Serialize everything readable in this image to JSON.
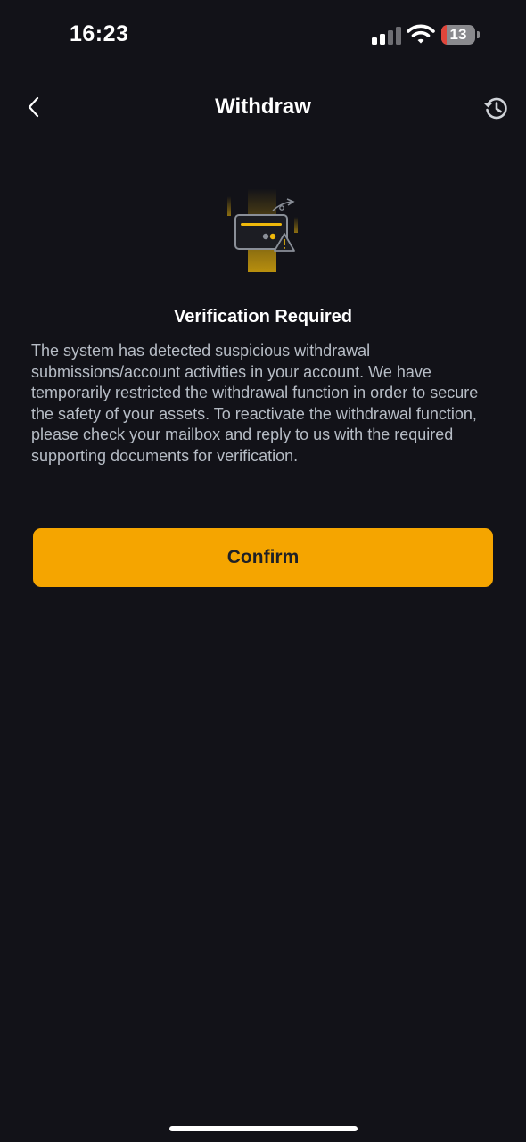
{
  "status_bar": {
    "time": "16:23",
    "battery_level": "13",
    "battery_color": "#e0453a",
    "icons": [
      "cellular-signal-icon",
      "wifi-icon",
      "battery-icon"
    ]
  },
  "nav": {
    "title": "Withdraw",
    "back_icon": "chevron-left-icon",
    "history_icon": "history-icon"
  },
  "verification": {
    "illustration_icon": "card-warning-icon",
    "heading": "Verification Required",
    "message": "The system has detected suspicious withdrawal submissions/account activities in your account. We have temporarily restricted the withdrawal function in order to secure the safety of your assets. To reactivate the withdrawal function, please check your mailbox and reply to us with the required supporting documents for verification."
  },
  "confirm_button": {
    "label": "Confirm"
  },
  "colors": {
    "background": "#121218",
    "accent": "#f5a500",
    "text_primary": "#ffffff",
    "text_secondary": "#b7bdc6"
  }
}
